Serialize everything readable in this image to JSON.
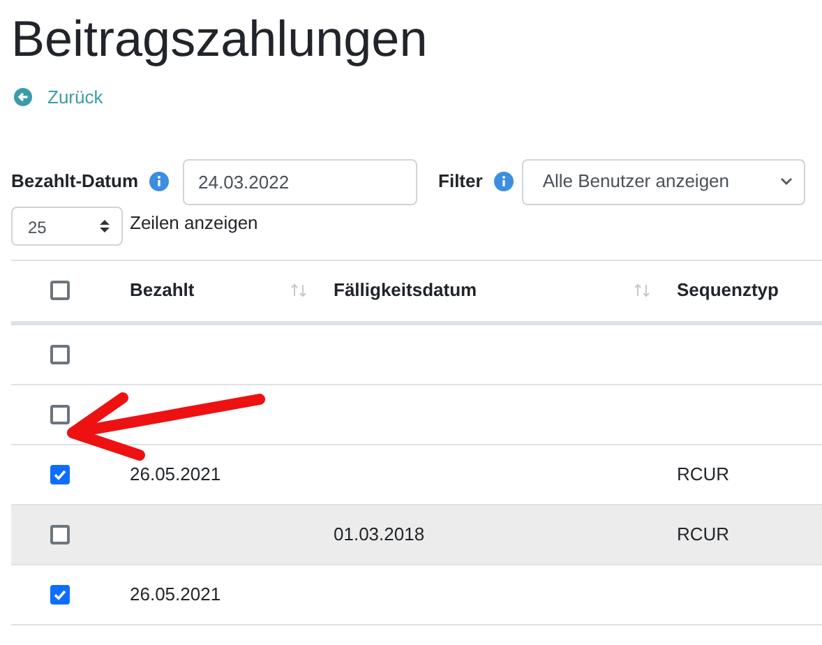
{
  "title": "Beitragszahlungen",
  "back_link": "Zurück",
  "filters": {
    "date_label": "Bezahlt-Datum",
    "date_value": "24.03.2022",
    "filter_label": "Filter",
    "filter_value": "Alle Benutzer anzeigen"
  },
  "page_size": {
    "value": "25",
    "label": "Zeilen anzeigen"
  },
  "table": {
    "select_all_checked": false,
    "columns": [
      {
        "label": "Bezahlt",
        "sortable": true
      },
      {
        "label": "Fälligkeitsdatum",
        "sortable": true
      },
      {
        "label": "Sequenztyp",
        "sortable": false
      }
    ],
    "rows": [
      {
        "checked": false,
        "highlighted": false,
        "cells": []
      },
      {
        "checked": false,
        "highlighted": false,
        "cells": []
      },
      {
        "checked": true,
        "highlighted": false,
        "cells": [
          "26.05.2021",
          "",
          "RCUR"
        ]
      },
      {
        "checked": false,
        "highlighted": true,
        "cells": [
          "",
          "01.03.2018",
          "RCUR"
        ]
      },
      {
        "checked": true,
        "highlighted": false,
        "cells": [
          "26.05.2021"
        ]
      }
    ]
  }
}
